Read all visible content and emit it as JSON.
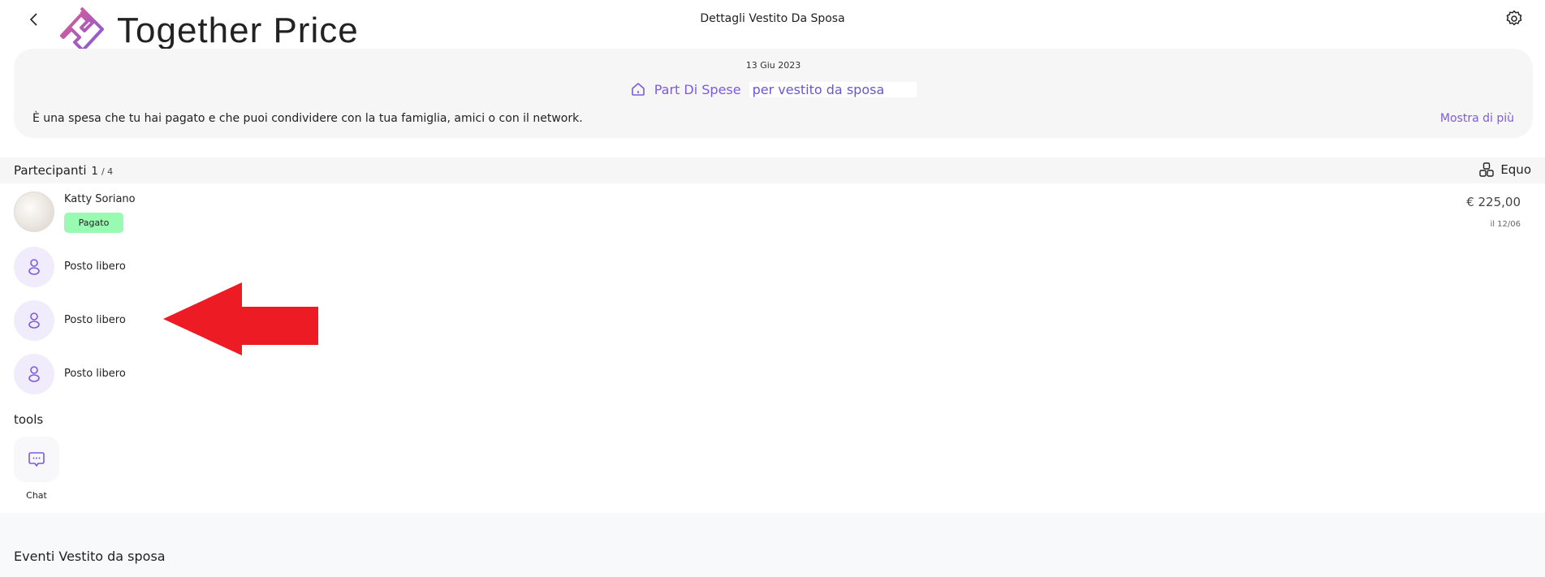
{
  "header": {
    "title": "Dettagli Vestito Da Sposa",
    "logo_text": "Together Price",
    "back_icon": "chevron-left-icon",
    "settings_icon": "gear-icon"
  },
  "summary": {
    "date": "13 Giu 2023",
    "heading_prefix": "Part Di Spese",
    "heading_suffix": "per vestito da sposa",
    "description": "È una spesa che tu hai pagato e che puoi condividere con la tua famiglia, amici o con il network.",
    "show_more": "Mostra di più"
  },
  "participants": {
    "label": "Partecipanti",
    "count": "1",
    "total": "/ 4",
    "split_mode": "Equo",
    "members": [
      {
        "name": "Katty Soriano",
        "status": "Pagato",
        "amount": "€ 225,00",
        "date": "il 12/06"
      }
    ],
    "free_slots": [
      "Posto libero",
      "Posto libero",
      "Posto libero"
    ]
  },
  "tools": {
    "label": "tools",
    "items": [
      {
        "label": "Chat",
        "icon": "chat-bubble-icon"
      }
    ]
  },
  "events": {
    "title": "Eventi Vestito da sposa"
  },
  "colors": {
    "accent": "#7b5ce0",
    "paid_badge": "#98fbb1",
    "annotation_arrow": "#ed1c24"
  }
}
